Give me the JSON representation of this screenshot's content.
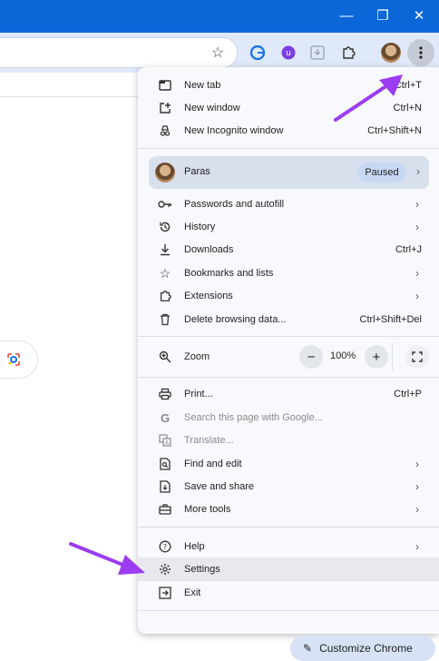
{
  "window": {
    "minimize_icon": "minimize-icon",
    "restore_icon": "restore-icon",
    "close_icon": "close-icon"
  },
  "toolbar": {
    "bookmark_star": "star-icon",
    "extensions": [
      "g-extension-icon",
      "purple-extension-icon",
      "download-extension-icon",
      "puzzle-icon"
    ],
    "profile_avatar": "avatar",
    "menu_button": "three-dots-icon"
  },
  "menu": {
    "section1": [
      {
        "label": "New tab",
        "shortcut": "Ctrl+T",
        "icon": "new-tab-icon"
      },
      {
        "label": "New window",
        "shortcut": "Ctrl+N",
        "icon": "new-window-icon"
      },
      {
        "label": "New Incognito window",
        "shortcut": "Ctrl+Shift+N",
        "icon": "incognito-icon"
      }
    ],
    "profile": {
      "name": "Paras",
      "status": "Paused"
    },
    "section2": [
      {
        "label": "Passwords and autofill",
        "icon": "key-icon"
      },
      {
        "label": "History",
        "icon": "history-icon"
      },
      {
        "label": "Downloads",
        "shortcut": "Ctrl+J",
        "icon": "download-icon"
      },
      {
        "label": "Bookmarks and lists",
        "icon": "star-icon"
      },
      {
        "label": "Extensions",
        "icon": "puzzle-icon"
      },
      {
        "label": "Delete browsing data...",
        "shortcut": "Ctrl+Shift+Del",
        "icon": "trash-icon"
      }
    ],
    "zoom": {
      "label": "Zoom",
      "value": "100%",
      "minus": "−",
      "plus": "+"
    },
    "section3": [
      {
        "label": "Print...",
        "shortcut": "Ctrl+P",
        "icon": "print-icon"
      },
      {
        "label": "Search this page with Google...",
        "icon": "google-icon"
      },
      {
        "label": "Translate...",
        "icon": "translate-icon"
      },
      {
        "label": "Find and edit",
        "icon": "find-icon"
      },
      {
        "label": "Save and share",
        "icon": "save-share-icon"
      },
      {
        "label": "More tools",
        "icon": "toolbox-icon"
      }
    ],
    "section4": [
      {
        "label": "Help",
        "icon": "help-icon"
      },
      {
        "label": "Settings",
        "icon": "gear-icon"
      },
      {
        "label": "Exit",
        "icon": "exit-icon"
      }
    ]
  },
  "customize_button": "Customize Chrome"
}
